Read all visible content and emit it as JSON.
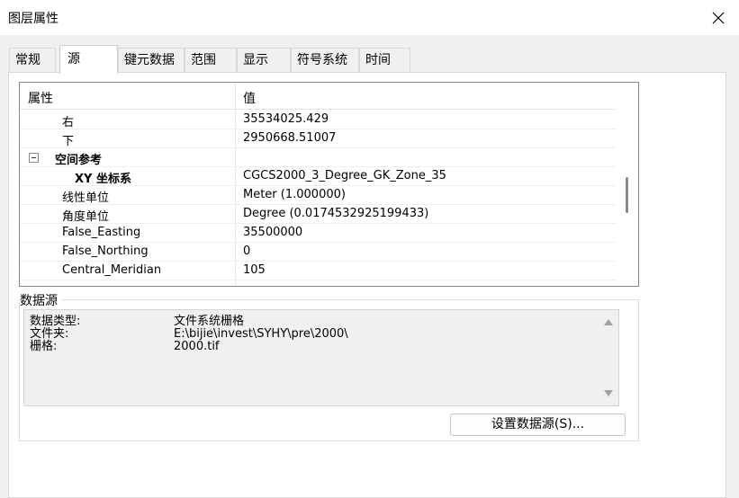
{
  "window": {
    "title": "图层属性"
  },
  "tabs": [
    {
      "label": "常规"
    },
    {
      "label": "源"
    },
    {
      "label": "键元数据"
    },
    {
      "label": "范围"
    },
    {
      "label": "显示"
    },
    {
      "label": "符号系统"
    },
    {
      "label": "时间"
    }
  ],
  "properties": {
    "col_property": "属性",
    "col_value": "值",
    "rows": [
      {
        "name": "右",
        "value": "35534025.429"
      },
      {
        "name": "下",
        "value": "2950668.51007"
      },
      {
        "name": "空间参考",
        "value": ""
      },
      {
        "name": "XY 坐标系",
        "value": "CGCS2000_3_Degree_GK_Zone_35"
      },
      {
        "name": "线性单位",
        "value": "Meter (1.000000)"
      },
      {
        "name": "角度单位",
        "value": "Degree (0.0174532925199433)"
      },
      {
        "name": "False_Easting",
        "value": "35500000"
      },
      {
        "name": "False_Northing",
        "value": "0"
      },
      {
        "name": "Central_Meridian",
        "value": "105"
      }
    ]
  },
  "datasource": {
    "group_label": "数据源",
    "items": [
      {
        "label": "数据类型:",
        "value": "文件系统栅格"
      },
      {
        "label": "文件夹:",
        "value": "E:\\bijie\\invest\\SYHY\\pre\\2000\\"
      },
      {
        "label": "栅格:",
        "value": "2000.tif"
      }
    ],
    "button_label": "设置数据源(S)..."
  }
}
